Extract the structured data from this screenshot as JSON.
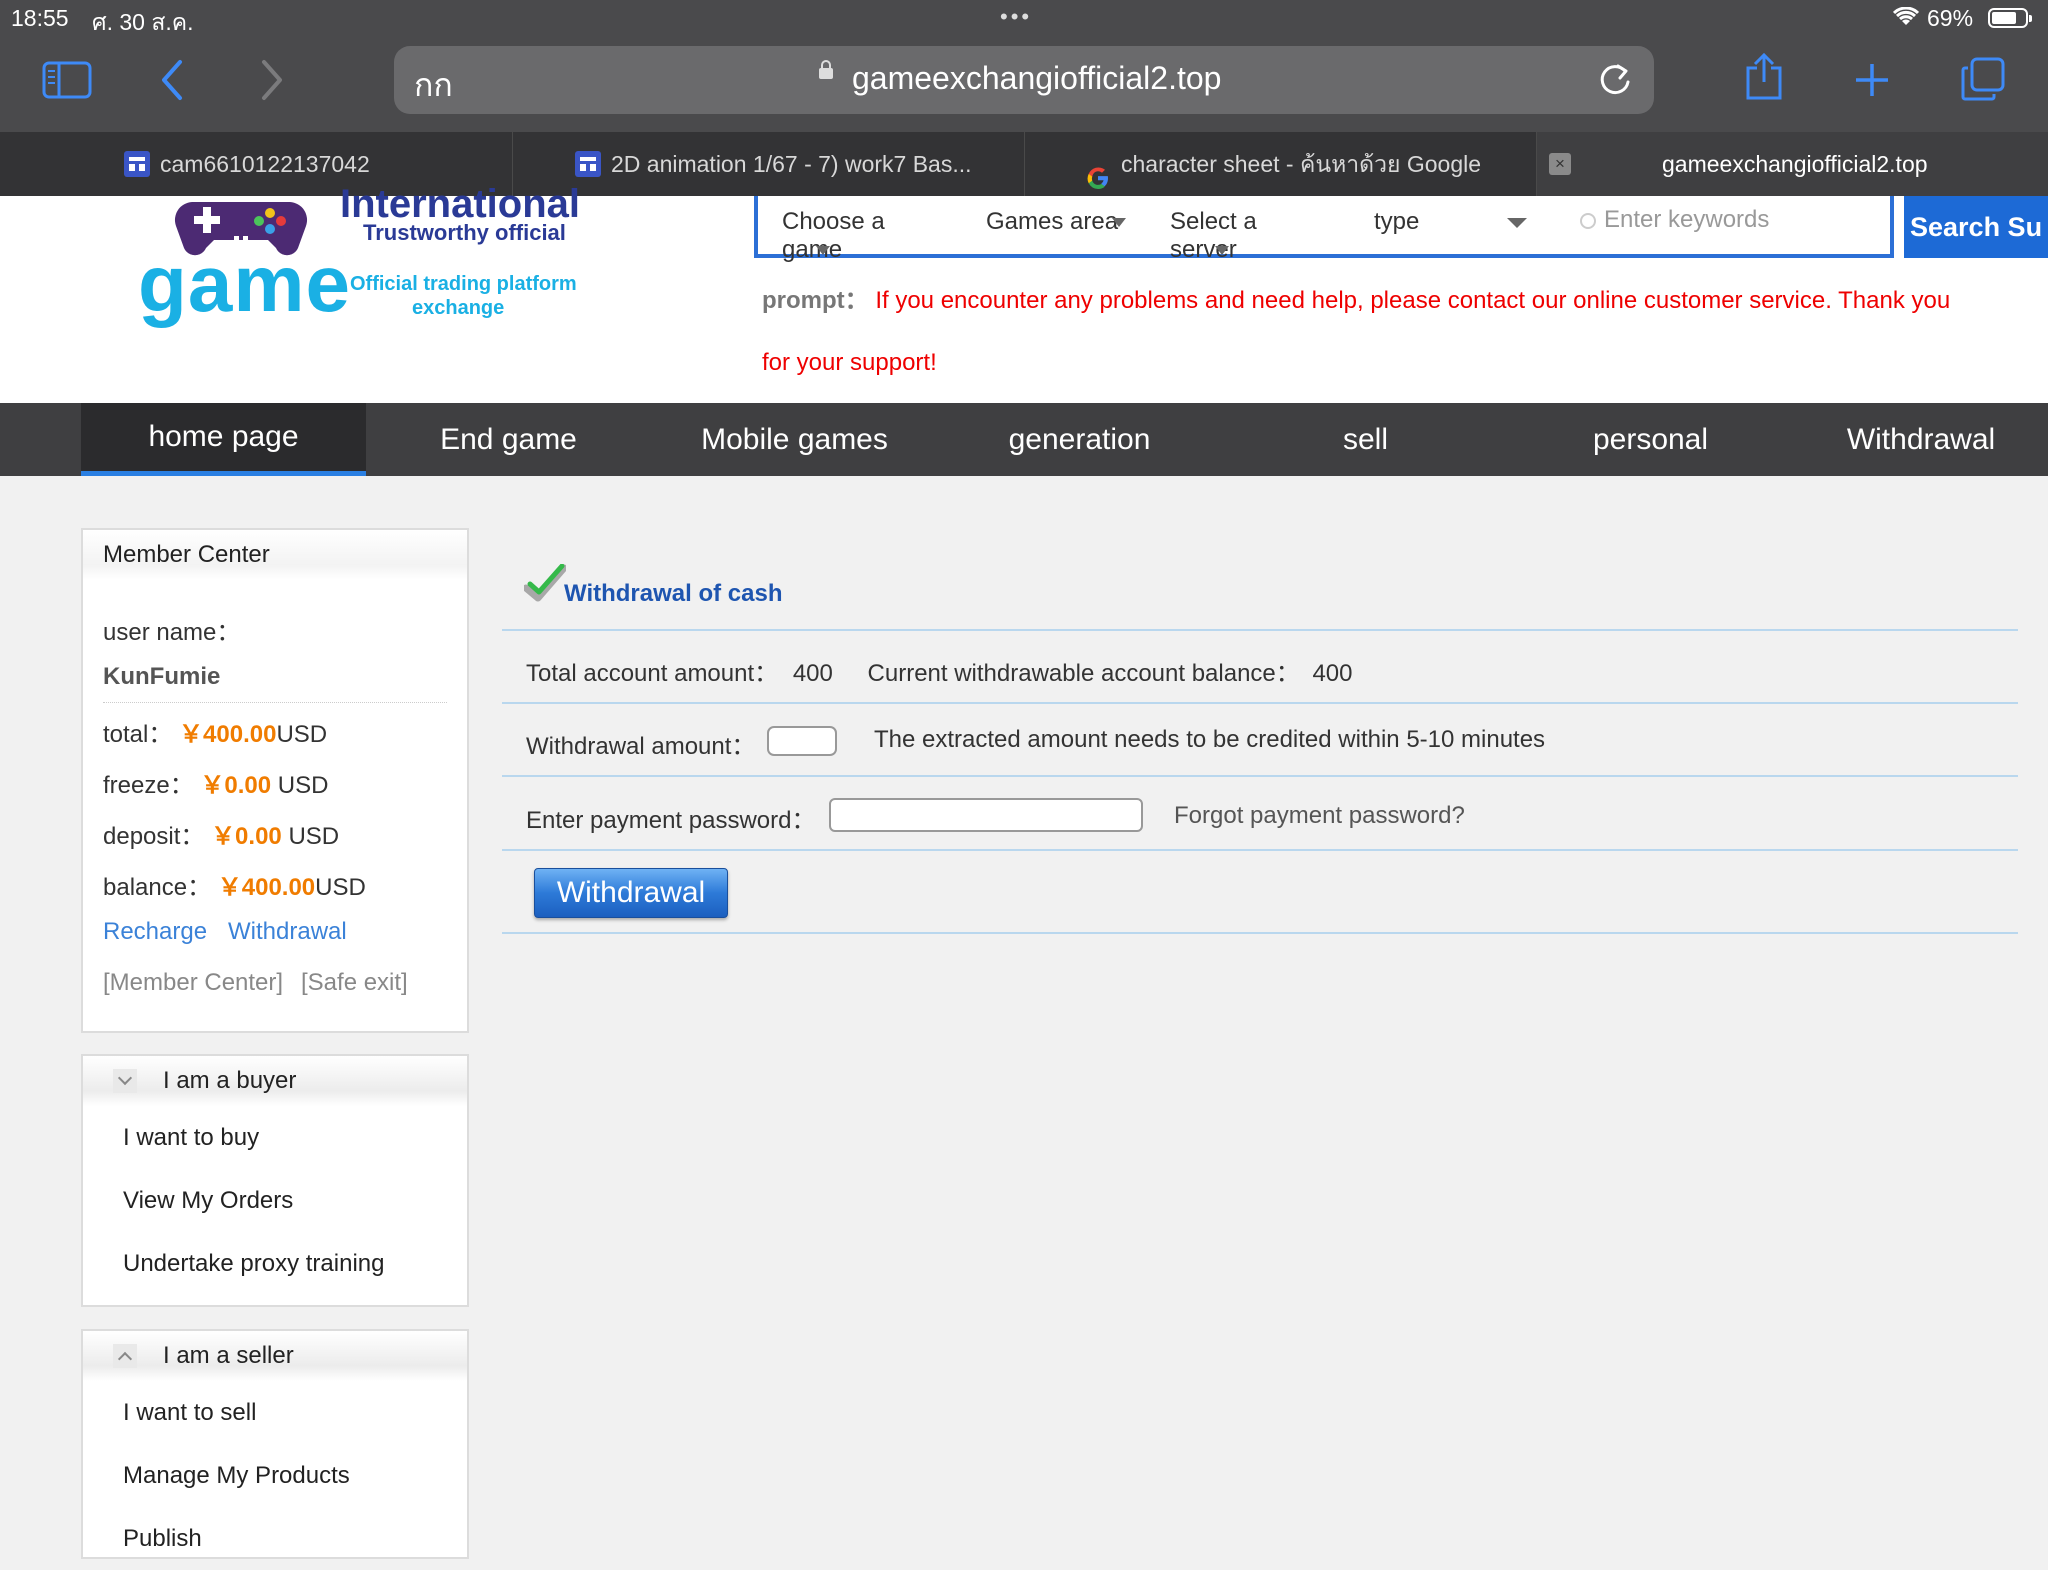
{
  "status": {
    "time": "18:55",
    "date": "ศ. 30 ส.ค.",
    "battery": "69%",
    "battery_level": 0.69
  },
  "browser": {
    "aa": "กก",
    "url": "gameexchangiofficial2.top",
    "tabs": [
      {
        "title": "cam6610122137042"
      },
      {
        "title": "2D animation 1/67 - 7) work7 Bas..."
      },
      {
        "title": "character sheet - ค้นหาด้วย Google"
      },
      {
        "title": "gameexchangiofficial2.top"
      }
    ],
    "close_tab": "×"
  },
  "logo": {
    "line1": "International",
    "line2": "Trustworthy official",
    "word": "game",
    "line3": "Official trading platform",
    "line4": "exchange"
  },
  "search": {
    "choose_game": "Choose a game",
    "games_area": "Games area",
    "select_server": "Select a server",
    "type": "type",
    "keywords_placeholder": "Enter keywords",
    "button": "Search Su"
  },
  "prompt": {
    "label": "prompt：",
    "text": "If you encounter any problems and need help, please contact our online customer service. Thank you for your support!"
  },
  "nav": [
    "home page",
    "End game",
    "Mobile games",
    "generation",
    "sell",
    "personal",
    "Withdrawal"
  ],
  "member_center": {
    "title": "Member Center",
    "username_label": "user name：",
    "username": "KunFumie",
    "total_label": "total：",
    "total": "￥400.00",
    "total_unit": "USD",
    "freeze_label": "freeze：",
    "freeze": "￥0.00",
    "freeze_unit": " USD",
    "deposit_label": "deposit：",
    "deposit": "￥0.00",
    "deposit_unit": " USD",
    "balance_label": "balance：",
    "balance": "￥400.00",
    "balance_unit": "USD",
    "recharge": "Recharge",
    "withdrawal": "Withdrawal",
    "member_center_link": "[Member Center]",
    "safe_exit": "[Safe exit]"
  },
  "buyer_menu": {
    "title": "I am a buyer",
    "items": [
      "I want to buy",
      "View My Orders",
      "Undertake proxy training"
    ]
  },
  "seller_menu": {
    "title": "I am a seller",
    "items": [
      "I want to sell",
      "Manage My Products",
      "Publish"
    ]
  },
  "withdraw": {
    "title": "Withdrawal of cash",
    "total_label": "Total account amount：",
    "total_value": "400",
    "current_label": "Current withdrawable account balance：",
    "current_value": "400",
    "amount_label": "Withdrawal amount：",
    "amount_note": "The extracted amount needs to be credited within 5-10 minutes",
    "password_label": "Enter payment password：",
    "forgot": "Forgot payment password?",
    "button": "Withdrawal"
  },
  "colors": {
    "accent": "#2a7fe2",
    "money": "#f07c00",
    "prompt": "#ee0000",
    "link": "#3b82d8"
  }
}
